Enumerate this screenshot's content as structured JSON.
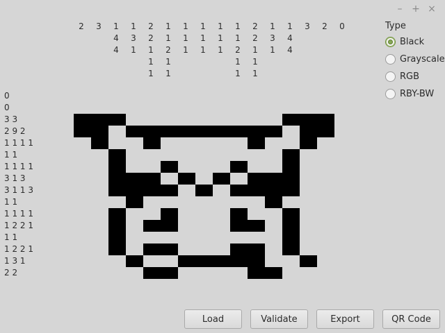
{
  "window": {
    "minimize": "–",
    "maximize": "+",
    "close": "×"
  },
  "type_panel": {
    "title": "Type",
    "selected": "Black",
    "options": [
      "Black",
      "Grayscale",
      "RGB",
      "RBY-BW"
    ]
  },
  "column_clues": [
    [
      "2"
    ],
    [
      "3"
    ],
    [
      "1",
      "4",
      "4"
    ],
    [
      "1",
      "3",
      "1"
    ],
    [
      "2",
      "2",
      "1",
      "1",
      "1"
    ],
    [
      "1",
      "1",
      "2",
      "1",
      "1"
    ],
    [
      "1",
      "1",
      "1"
    ],
    [
      "1",
      "1",
      "1"
    ],
    [
      "1",
      "1",
      "1"
    ],
    [
      "1",
      "1",
      "2",
      "1",
      "1"
    ],
    [
      "2",
      "2",
      "1",
      "1",
      "1"
    ],
    [
      "1",
      "3",
      "1"
    ],
    [
      "1",
      "4",
      "4"
    ],
    [
      "3"
    ],
    [
      "2"
    ],
    [
      "0"
    ]
  ],
  "row_clues": [
    "0",
    "0",
    "3 3",
    "2 9 2",
    "1 1 1 1",
    "1 1",
    "1 1 1 1",
    "3 1 3",
    "3 1 1 3",
    "1 1",
    "1 1 1 1",
    "1 2 2 1",
    "1 1",
    "1 2 2 1",
    "1 3 1",
    "2 2"
  ],
  "grid": [
    "111000000000111",
    "110111111111011",
    "010010000010010",
    "001000000000100",
    "001003000300100",
    "001110101011100",
    "001111010111100",
    "000100000001000",
    "001003000300100",
    "001011000110100",
    "001000000000100",
    "001011000110100",
    "000100111110010",
    "000011000011000"
  ],
  "buttons": {
    "load": "Load",
    "validate": "Validate",
    "export": "Export",
    "qr": "QR Code"
  },
  "colors": {
    "filled": "#000000",
    "background": "#d6d6d6",
    "radio_accent": "#88a857"
  }
}
